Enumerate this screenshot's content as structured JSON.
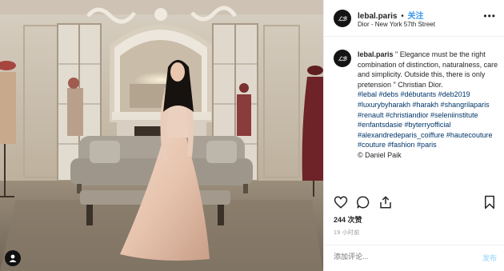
{
  "post": {
    "username": "lebal.paris",
    "follow_dot": "•",
    "follow_label": "关注",
    "location": "Dior - New York 57th Street",
    "avatar_text": "ℒℬ",
    "more_label": "•••"
  },
  "caption": {
    "username": "lebal.paris",
    "text": "\" Elegance must be the right combination of distinction, naturalness, care and simplicity. Outside this, there is only pretension \" Christian Dior.",
    "hashtags": "#lebal #debs #débutants #deb2019 #luxurybyharakh #harakh #shangrilaparis #renault #christiandior #seleniinstitute #enfantsdasie #byterryofficial #alexandredeparis_coiffure #hautecouture #couture #fashion #paris",
    "credit": "© Daniel Paik"
  },
  "stats": {
    "likes": "244 次赞",
    "time_ago": "19 小时前"
  },
  "comment": {
    "placeholder": "添加评论...",
    "post_label": "发布"
  },
  "colors": {
    "accent": "#3897f0",
    "hashtag": "#003569",
    "muted": "#999999",
    "post_disabled": "#b2dffc"
  },
  "icons": [
    "heart-icon",
    "comment-icon",
    "share-icon",
    "bookmark-icon",
    "more-icon",
    "user-tag-icon"
  ]
}
